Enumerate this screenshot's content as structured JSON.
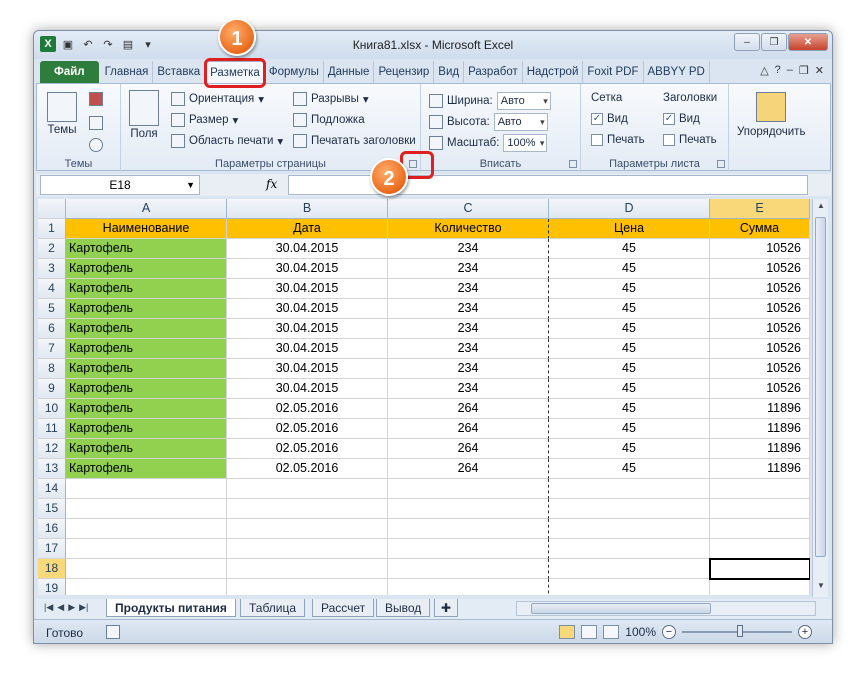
{
  "window": {
    "title": "Книга81.xlsx - Microsoft Excel"
  },
  "tabs": [
    "Файл",
    "Главная",
    "Вставка",
    "Разметка",
    "Формулы",
    "Данные",
    "Рецензир",
    "Вид",
    "Разработ",
    "Надстрой",
    "Foxit PDF",
    "ABBYY PD"
  ],
  "ribbon": {
    "themes": {
      "label": "Темы",
      "group": "Темы"
    },
    "page_setup": {
      "group": "Параметры страницы",
      "margins": "Поля",
      "orientation": "Ориентация",
      "size": "Размер",
      "print_area": "Область печати",
      "breaks": "Разрывы",
      "background": "Подложка",
      "print_titles": "Печатать заголовки"
    },
    "scale": {
      "group": "Вписать",
      "width_label": "Ширина:",
      "width_value": "Авто",
      "height_label": "Высота:",
      "height_value": "Авто",
      "scale_label": "Масштаб:",
      "scale_value": "100%"
    },
    "sheet_options": {
      "group": "Параметры листа",
      "gridlines": "Сетка",
      "headings": "Заголовки",
      "view": "Вид",
      "print": "Печать"
    },
    "arrange": {
      "label": "Упорядочить"
    }
  },
  "formula_bar": {
    "name_box": "E18",
    "fx": "fx",
    "value": ""
  },
  "columns": [
    "A",
    "B",
    "C",
    "D",
    "E"
  ],
  "table": {
    "headers": [
      "Наименование",
      "Дата",
      "Количество",
      "Цена",
      "Сумма"
    ],
    "rows": [
      [
        "Картофель",
        "30.04.2015",
        "234",
        "45",
        "10526"
      ],
      [
        "Картофель",
        "30.04.2015",
        "234",
        "45",
        "10526"
      ],
      [
        "Картофель",
        "30.04.2015",
        "234",
        "45",
        "10526"
      ],
      [
        "Картофель",
        "30.04.2015",
        "234",
        "45",
        "10526"
      ],
      [
        "Картофель",
        "30.04.2015",
        "234",
        "45",
        "10526"
      ],
      [
        "Картофель",
        "30.04.2015",
        "234",
        "45",
        "10526"
      ],
      [
        "Картофель",
        "30.04.2015",
        "234",
        "45",
        "10526"
      ],
      [
        "Картофель",
        "30.04.2015",
        "234",
        "45",
        "10526"
      ],
      [
        "Картофель",
        "02.05.2016",
        "264",
        "45",
        "11896"
      ],
      [
        "Картофель",
        "02.05.2016",
        "264",
        "45",
        "11896"
      ],
      [
        "Картофель",
        "02.05.2016",
        "264",
        "45",
        "11896"
      ],
      [
        "Картофель",
        "02.05.2016",
        "264",
        "45",
        "11896"
      ]
    ]
  },
  "row_numbers": [
    "1",
    "2",
    "3",
    "4",
    "5",
    "6",
    "7",
    "8",
    "9",
    "10",
    "11",
    "12",
    "13",
    "14",
    "15",
    "16",
    "17",
    "18",
    "19"
  ],
  "sheets": [
    "Продукты питания",
    "Таблица",
    "Рассчет",
    "Вывод"
  ],
  "status": {
    "ready": "Готово",
    "zoom": "100%"
  },
  "callouts": [
    "1",
    "2"
  ],
  "colors": {
    "header_fill": "#ffc000",
    "name_fill": "#92d050",
    "callout": "#ea6a1c",
    "highlight": "#e02020"
  }
}
